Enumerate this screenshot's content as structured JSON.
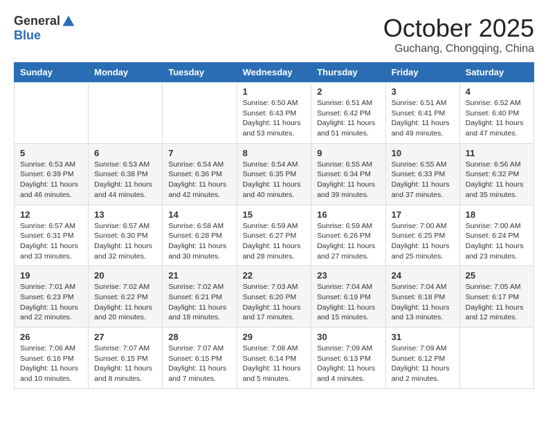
{
  "logo": {
    "general": "General",
    "blue": "Blue"
  },
  "title": "October 2025",
  "location": "Guchang, Chongqing, China",
  "weekdays": [
    "Sunday",
    "Monday",
    "Tuesday",
    "Wednesday",
    "Thursday",
    "Friday",
    "Saturday"
  ],
  "weeks": [
    [
      {
        "day": "",
        "info": ""
      },
      {
        "day": "",
        "info": ""
      },
      {
        "day": "",
        "info": ""
      },
      {
        "day": "1",
        "info": "Sunrise: 6:50 AM\nSunset: 6:43 PM\nDaylight: 11 hours\nand 53 minutes."
      },
      {
        "day": "2",
        "info": "Sunrise: 6:51 AM\nSunset: 6:42 PM\nDaylight: 11 hours\nand 51 minutes."
      },
      {
        "day": "3",
        "info": "Sunrise: 6:51 AM\nSunset: 6:41 PM\nDaylight: 11 hours\nand 49 minutes."
      },
      {
        "day": "4",
        "info": "Sunrise: 6:52 AM\nSunset: 6:40 PM\nDaylight: 11 hours\nand 47 minutes."
      }
    ],
    [
      {
        "day": "5",
        "info": "Sunrise: 6:53 AM\nSunset: 6:39 PM\nDaylight: 11 hours\nand 46 minutes."
      },
      {
        "day": "6",
        "info": "Sunrise: 6:53 AM\nSunset: 6:38 PM\nDaylight: 11 hours\nand 44 minutes."
      },
      {
        "day": "7",
        "info": "Sunrise: 6:54 AM\nSunset: 6:36 PM\nDaylight: 11 hours\nand 42 minutes."
      },
      {
        "day": "8",
        "info": "Sunrise: 6:54 AM\nSunset: 6:35 PM\nDaylight: 11 hours\nand 40 minutes."
      },
      {
        "day": "9",
        "info": "Sunrise: 6:55 AM\nSunset: 6:34 PM\nDaylight: 11 hours\nand 39 minutes."
      },
      {
        "day": "10",
        "info": "Sunrise: 6:55 AM\nSunset: 6:33 PM\nDaylight: 11 hours\nand 37 minutes."
      },
      {
        "day": "11",
        "info": "Sunrise: 6:56 AM\nSunset: 6:32 PM\nDaylight: 11 hours\nand 35 minutes."
      }
    ],
    [
      {
        "day": "12",
        "info": "Sunrise: 6:57 AM\nSunset: 6:31 PM\nDaylight: 11 hours\nand 33 minutes."
      },
      {
        "day": "13",
        "info": "Sunrise: 6:57 AM\nSunset: 6:30 PM\nDaylight: 11 hours\nand 32 minutes."
      },
      {
        "day": "14",
        "info": "Sunrise: 6:58 AM\nSunset: 6:28 PM\nDaylight: 11 hours\nand 30 minutes."
      },
      {
        "day": "15",
        "info": "Sunrise: 6:59 AM\nSunset: 6:27 PM\nDaylight: 11 hours\nand 28 minutes."
      },
      {
        "day": "16",
        "info": "Sunrise: 6:59 AM\nSunset: 6:26 PM\nDaylight: 11 hours\nand 27 minutes."
      },
      {
        "day": "17",
        "info": "Sunrise: 7:00 AM\nSunset: 6:25 PM\nDaylight: 11 hours\nand 25 minutes."
      },
      {
        "day": "18",
        "info": "Sunrise: 7:00 AM\nSunset: 6:24 PM\nDaylight: 11 hours\nand 23 minutes."
      }
    ],
    [
      {
        "day": "19",
        "info": "Sunrise: 7:01 AM\nSunset: 6:23 PM\nDaylight: 11 hours\nand 22 minutes."
      },
      {
        "day": "20",
        "info": "Sunrise: 7:02 AM\nSunset: 6:22 PM\nDaylight: 11 hours\nand 20 minutes."
      },
      {
        "day": "21",
        "info": "Sunrise: 7:02 AM\nSunset: 6:21 PM\nDaylight: 11 hours\nand 18 minutes."
      },
      {
        "day": "22",
        "info": "Sunrise: 7:03 AM\nSunset: 6:20 PM\nDaylight: 11 hours\nand 17 minutes."
      },
      {
        "day": "23",
        "info": "Sunrise: 7:04 AM\nSunset: 6:19 PM\nDaylight: 11 hours\nand 15 minutes."
      },
      {
        "day": "24",
        "info": "Sunrise: 7:04 AM\nSunset: 6:18 PM\nDaylight: 11 hours\nand 13 minutes."
      },
      {
        "day": "25",
        "info": "Sunrise: 7:05 AM\nSunset: 6:17 PM\nDaylight: 11 hours\nand 12 minutes."
      }
    ],
    [
      {
        "day": "26",
        "info": "Sunrise: 7:06 AM\nSunset: 6:16 PM\nDaylight: 11 hours\nand 10 minutes."
      },
      {
        "day": "27",
        "info": "Sunrise: 7:07 AM\nSunset: 6:15 PM\nDaylight: 11 hours\nand 8 minutes."
      },
      {
        "day": "28",
        "info": "Sunrise: 7:07 AM\nSunset: 6:15 PM\nDaylight: 11 hours\nand 7 minutes."
      },
      {
        "day": "29",
        "info": "Sunrise: 7:08 AM\nSunset: 6:14 PM\nDaylight: 11 hours\nand 5 minutes."
      },
      {
        "day": "30",
        "info": "Sunrise: 7:09 AM\nSunset: 6:13 PM\nDaylight: 11 hours\nand 4 minutes."
      },
      {
        "day": "31",
        "info": "Sunrise: 7:09 AM\nSunset: 6:12 PM\nDaylight: 11 hours\nand 2 minutes."
      },
      {
        "day": "",
        "info": ""
      }
    ]
  ]
}
